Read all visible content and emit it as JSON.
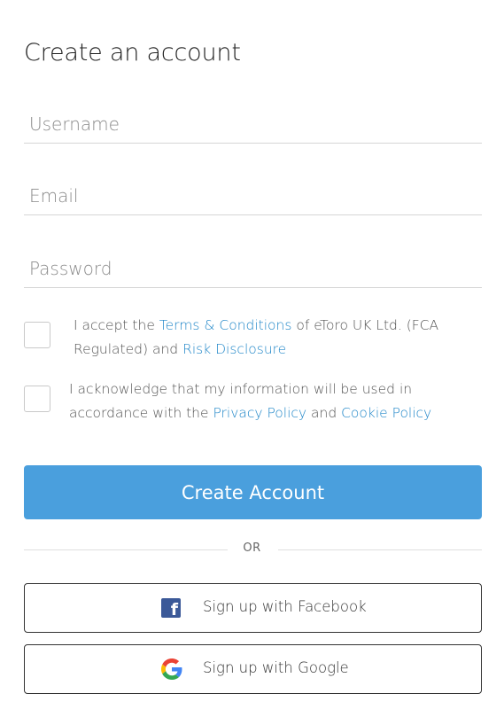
{
  "form": {
    "title": "Create an account",
    "username_placeholder": "Username",
    "email_placeholder": "Email",
    "password_placeholder": "Password"
  },
  "consents": {
    "terms": {
      "prefix": "I accept the ",
      "terms_link": "Terms & Conditions",
      "middle": " of eToro UK Ltd. (FCA Regulated) and ",
      "risk_link": "Risk Disclosure"
    },
    "privacy": {
      "prefix": "I acknowledge that my information will be used in accordance with the ",
      "privacy_link": "Privacy Policy",
      "middle": " and ",
      "cookie_link": "Cookie Policy"
    }
  },
  "actions": {
    "create_label": "Create Account",
    "or_label": "OR",
    "facebook_label": "Sign up with Facebook",
    "google_label": "Sign up with Google"
  },
  "colors": {
    "primary": "#4a9fdd",
    "link": "#1f86c8",
    "facebook": "#3b5998"
  },
  "icons": {
    "facebook": "facebook-icon",
    "google": "google-icon"
  }
}
